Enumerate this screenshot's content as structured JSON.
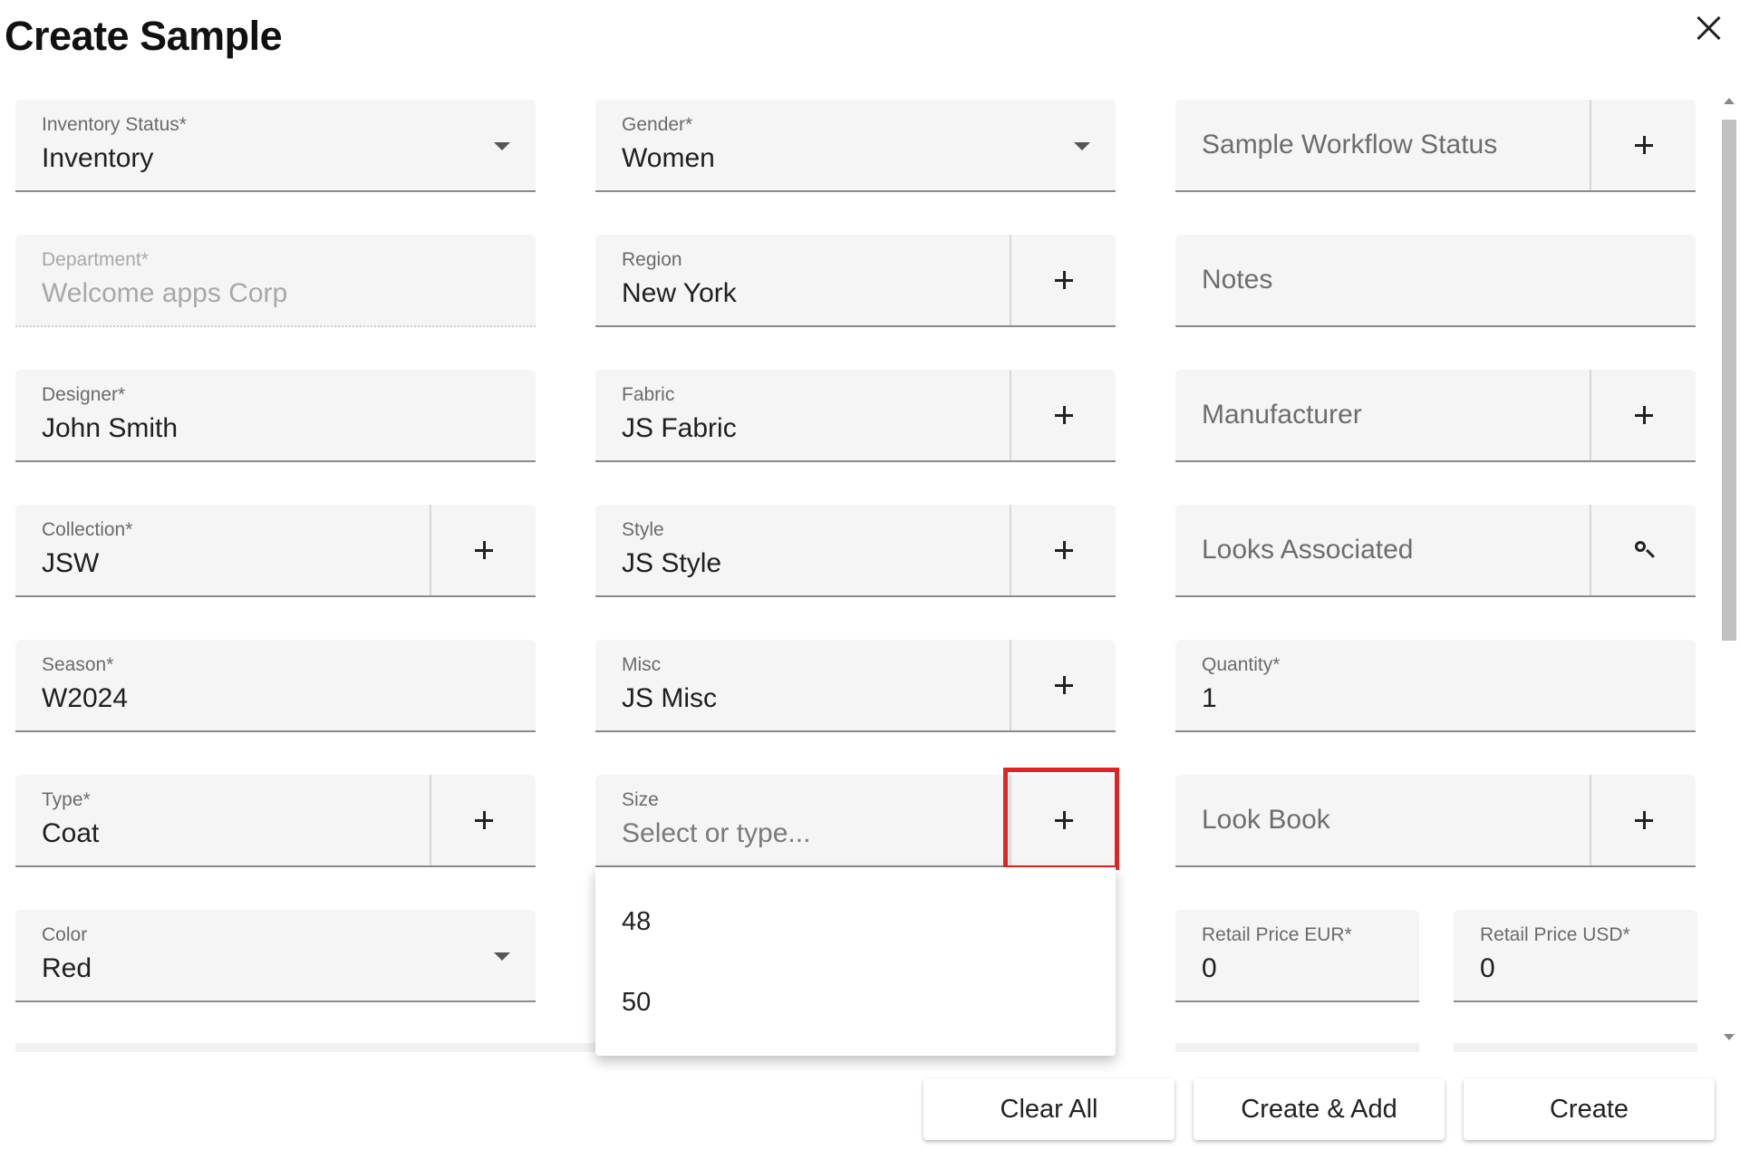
{
  "dialog": {
    "title": "Create Sample"
  },
  "fields": {
    "inventory_status": {
      "label": "Inventory Status*",
      "value": "Inventory"
    },
    "gender": {
      "label": "Gender*",
      "value": "Women"
    },
    "sample_workflow_status": {
      "placeholder": "Sample Workflow Status"
    },
    "department": {
      "label": "Department*",
      "value": "Welcome apps Corp"
    },
    "region": {
      "label": "Region",
      "value": "New York"
    },
    "notes": {
      "placeholder": "Notes"
    },
    "designer": {
      "label": "Designer*",
      "value": "John Smith"
    },
    "fabric": {
      "label": "Fabric",
      "value": "JS Fabric"
    },
    "manufacturer": {
      "placeholder": "Manufacturer"
    },
    "collection": {
      "label": "Collection*",
      "value": "JSW"
    },
    "style": {
      "label": "Style",
      "value": "JS Style"
    },
    "looks_associated": {
      "placeholder": "Looks Associated"
    },
    "season": {
      "label": "Season*",
      "value": "W2024"
    },
    "misc": {
      "label": "Misc",
      "value": "JS Misc"
    },
    "quantity": {
      "label": "Quantity*",
      "value": "1"
    },
    "type": {
      "label": "Type*",
      "value": "Coat"
    },
    "size": {
      "label": "Size",
      "placeholder": "Select or type..."
    },
    "look_book": {
      "placeholder": "Look Book"
    },
    "color": {
      "label": "Color",
      "value": "Red"
    },
    "retail_price_eur": {
      "label": "Retail Price EUR*",
      "value": "0"
    },
    "retail_price_usd": {
      "label": "Retail Price USD*",
      "value": "0"
    }
  },
  "size_dropdown": {
    "options": [
      "48",
      "50"
    ]
  },
  "footer": {
    "clear_all": "Clear All",
    "create_add": "Create & Add",
    "create": "Create"
  },
  "icons": {
    "close": "close-icon",
    "add": "plus-icon",
    "search": "search-icon",
    "dropdown": "caret-down-icon"
  },
  "colors": {
    "highlight": "#e02424",
    "field_bg": "#f5f5f5"
  }
}
